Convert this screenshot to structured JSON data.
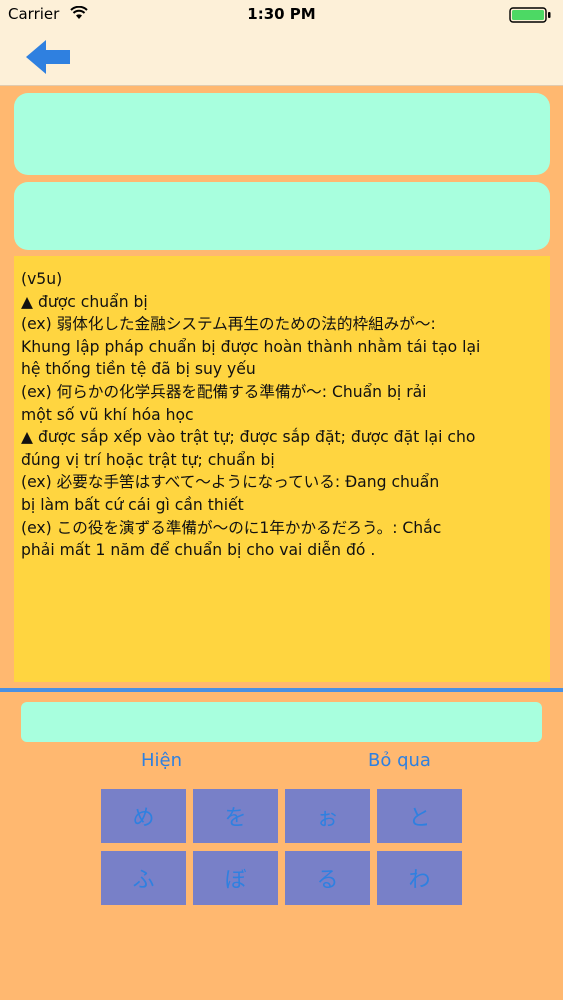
{
  "status_bar": {
    "carrier": "Carrier",
    "time": "1:30 PM"
  },
  "nav": {
    "back_icon": "back-arrow-icon",
    "accent_color": "#2F80E0"
  },
  "meaning_lines": [
    "(v5u)",
    "▲ được chuẩn bị",
    "(ex) 弱体化した金融システム再生のための法的枠組みが～:",
    "Khung lập pháp chuẩn bị được hoàn thành nhằm tái tạo lại",
    "hệ thống tiền tệ đã bị suy yếu",
    "(ex) 何らかの化学兵器を配備する準備が～: Chuẩn bị rải",
    "một số vũ khí hóa học",
    "▲ được sắp xếp vào trật tự; được sắp đặt; được đặt lại cho",
    "đúng vị trí hoặc trật tự; chuẩn bị",
    "(ex) 必要な手筈はすべて～ようになっている: Đang chuẩn",
    "bị làm bất cứ cái gì cần thiết",
    "(ex) この役を演ずる準備が～のに1年かかるだろう。: Chắc",
    "phải mất 1 năm để chuẩn bị cho vai diễn đó ."
  ],
  "answer": {
    "value": "",
    "placeholder": ""
  },
  "buttons": {
    "show_label": "Hiện",
    "skip_label": "Bỏ qua"
  },
  "keys": [
    "め",
    "を",
    "ぉ",
    "と",
    "ふ",
    "ぼ",
    "る",
    "わ"
  ],
  "colors": {
    "background": "#FFB870",
    "card": "#A8FFDE",
    "meaning_panel": "#FFD540",
    "key": "#7880C8",
    "divider": "#4A90E2"
  }
}
